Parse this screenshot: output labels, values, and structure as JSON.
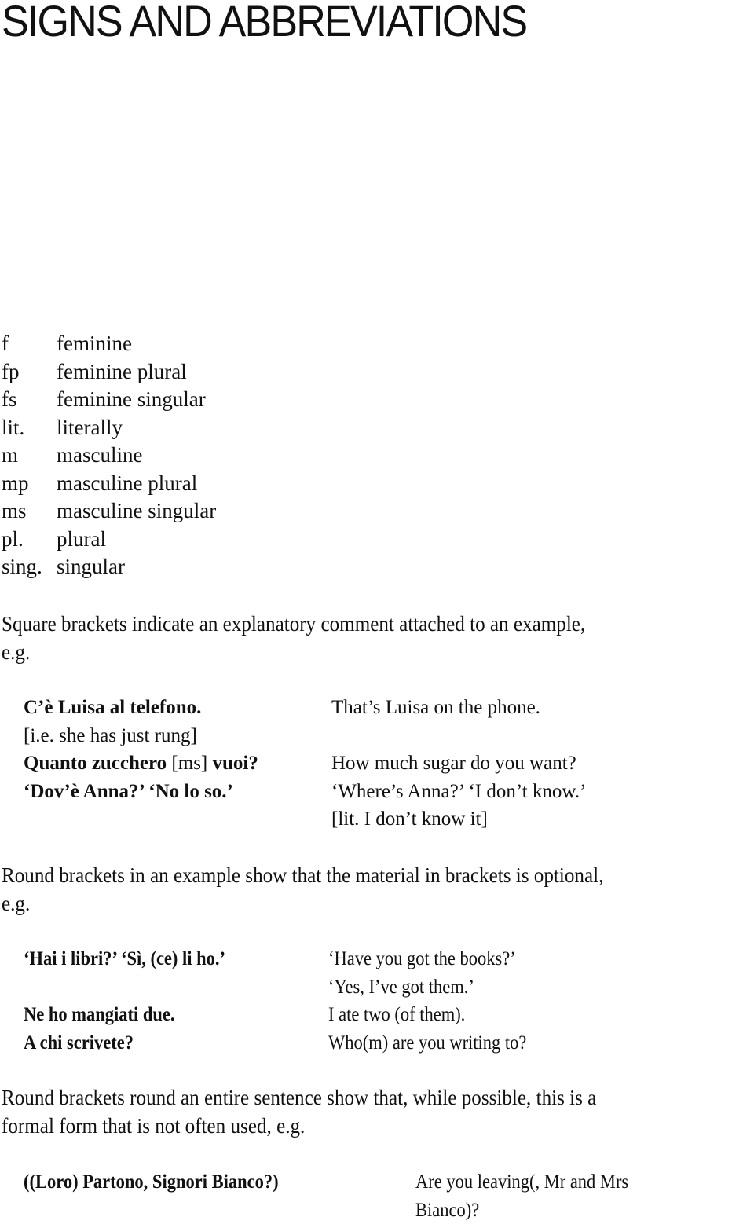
{
  "page_title": "SIGNS AND ABBREVIATIONS",
  "abbreviations": [
    {
      "abbr": "f",
      "meaning": "feminine"
    },
    {
      "abbr": "fp",
      "meaning": "feminine plural"
    },
    {
      "abbr": "fs",
      "meaning": "feminine singular"
    },
    {
      "abbr": "lit.",
      "meaning": "literally"
    },
    {
      "abbr": "m",
      "meaning": "masculine"
    },
    {
      "abbr": "mp",
      "meaning": "masculine plural"
    },
    {
      "abbr": "ms",
      "meaning": "masculine singular"
    },
    {
      "abbr": "pl.",
      "meaning": "plural"
    },
    {
      "abbr": "sing.",
      "meaning": "singular"
    }
  ],
  "square_brackets": {
    "intro_line1": "Square brackets indicate an explanatory comment attached to an example,",
    "intro_line2": "e.g.",
    "examples": {
      "it1": "C’è Luisa al telefono.",
      "it1_note": "[i.e. she has just rung]",
      "it2_a": "Quanto zucchero",
      "it2_note": "[ms]",
      "it2_b": "vuoi?",
      "it3": "‘Dov’è Anna?’ ‘No lo so.’",
      "en1": "That’s Luisa on the phone.",
      "en2": "How much sugar do you want?",
      "en3": "‘Where’s Anna?’ ‘I don’t know.’",
      "en3_note": "[lit. I don’t know it]"
    }
  },
  "round_brackets": {
    "intro_line1": "Round brackets in an example show that the material in brackets is optional,",
    "intro_line2": "e.g.",
    "examples": {
      "it1": "‘Hai i libri?’ ‘Sì, (ce) li ho.’",
      "en1a": "‘Have you got the books?’",
      "en1b": "‘Yes, I’ve got them.’",
      "it2": "Ne ho mangiati due.",
      "en2": "I ate two (of them).",
      "it3": "A chi scrivete?",
      "en3": "Who(m) are you writing to?"
    }
  },
  "round_sentence": {
    "intro_line1": "Round brackets round an entire sentence show that, while possible, this is a",
    "intro_line2": "formal form that is not often used, e.g.",
    "example_it": "((Loro) Partono, Signori Bianco?)",
    "example_en_line1": "Are you leaving(, Mr and Mrs",
    "example_en_line2": "Bianco)?"
  }
}
